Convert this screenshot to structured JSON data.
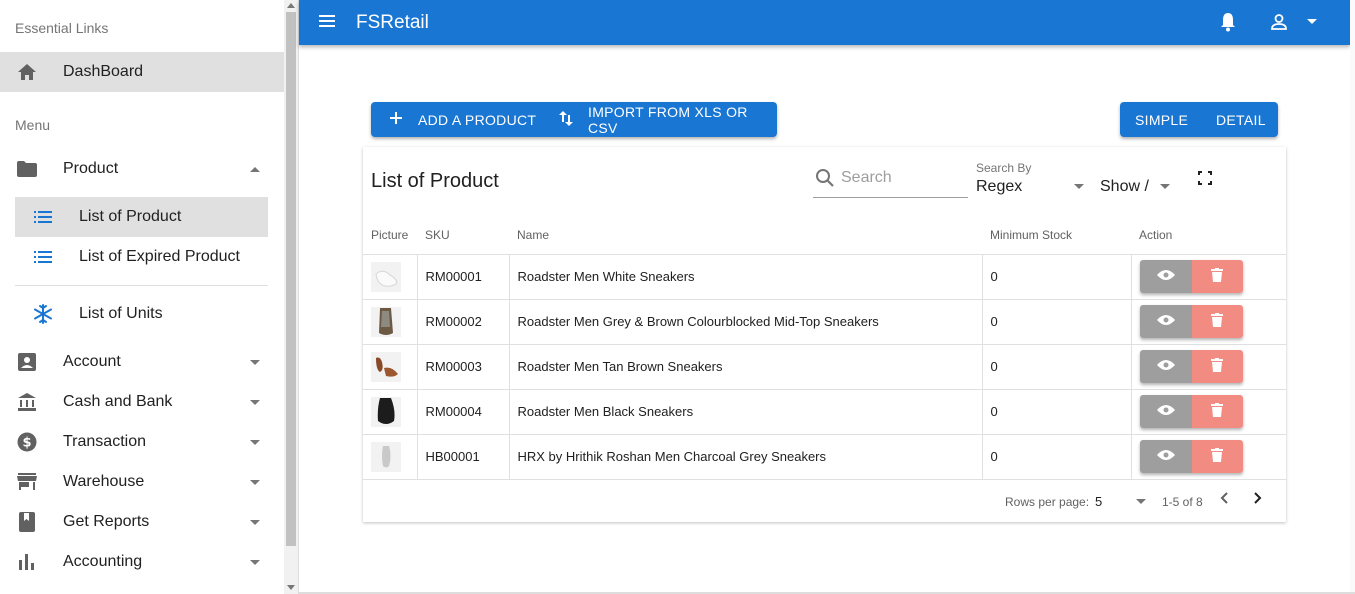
{
  "app": {
    "title": "FSRetail"
  },
  "sidebar": {
    "essential_header": "Essential Links",
    "dashboard": "DashBoard",
    "menu_header": "Menu",
    "product": "Product",
    "product_sub": [
      "List of Product",
      "List of Expired Product"
    ],
    "units": "List of Units",
    "items": [
      "Account",
      "Cash and Bank",
      "Transaction",
      "Warehouse",
      "Get Reports",
      "Accounting"
    ]
  },
  "toolbar": {
    "add_label": "ADD A PRODUCT",
    "import_label": "IMPORT FROM XLS OR CSV",
    "simple_label": "SIMPLE",
    "detail_label": "DETAIL"
  },
  "card": {
    "title": "List of Product",
    "search_placeholder": "Search",
    "search_by_label": "Search By",
    "search_by_value": "Regex",
    "show_value": "Show /"
  },
  "table": {
    "headers": [
      "Picture",
      "SKU",
      "Name",
      "Minimum Stock",
      "Action"
    ],
    "rows": [
      {
        "sku": "RM00001",
        "name": "Roadster Men White Sneakers",
        "min_stock": "0"
      },
      {
        "sku": "RM00002",
        "name": "Roadster Men Grey & Brown Colourblocked Mid-Top Sneakers",
        "min_stock": "0"
      },
      {
        "sku": "RM00003",
        "name": "Roadster Men Tan Brown Sneakers",
        "min_stock": "0"
      },
      {
        "sku": "RM00004",
        "name": "Roadster Men Black Sneakers",
        "min_stock": "0"
      },
      {
        "sku": "HB00001",
        "name": "HRX by Hrithik Roshan Men Charcoal Grey Sneakers",
        "min_stock": "0"
      }
    ]
  },
  "pager": {
    "rows_per_page_label": "Rows per page:",
    "rows_per_page": "5",
    "range": "1-5 of 8"
  },
  "colors": {
    "primary": "#1976d2",
    "delete": "#f28b82",
    "view": "#9e9e9e"
  }
}
